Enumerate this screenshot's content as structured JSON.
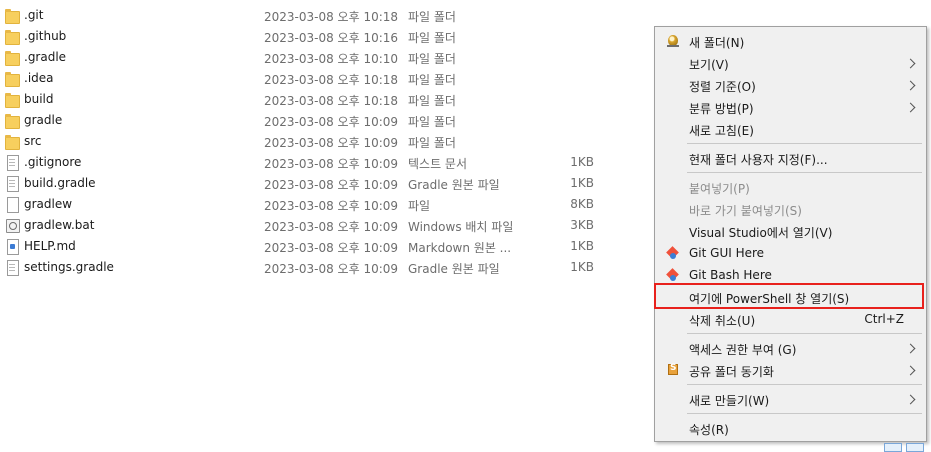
{
  "files": [
    {
      "icon": "folder",
      "name": ".git",
      "date": "2023-03-08 오후 10:18",
      "type": "파일 폴더",
      "size": ""
    },
    {
      "icon": "folder",
      "name": ".github",
      "date": "2023-03-08 오후 10:16",
      "type": "파일 폴더",
      "size": ""
    },
    {
      "icon": "folder",
      "name": ".gradle",
      "date": "2023-03-08 오후 10:10",
      "type": "파일 폴더",
      "size": ""
    },
    {
      "icon": "folder",
      "name": ".idea",
      "date": "2023-03-08 오후 10:18",
      "type": "파일 폴더",
      "size": ""
    },
    {
      "icon": "folder",
      "name": "build",
      "date": "2023-03-08 오후 10:18",
      "type": "파일 폴더",
      "size": ""
    },
    {
      "icon": "folder",
      "name": "gradle",
      "date": "2023-03-08 오후 10:09",
      "type": "파일 폴더",
      "size": ""
    },
    {
      "icon": "folder",
      "name": "src",
      "date": "2023-03-08 오후 10:09",
      "type": "파일 폴더",
      "size": ""
    },
    {
      "icon": "doc-lined",
      "name": ".gitignore",
      "date": "2023-03-08 오후 10:09",
      "type": "텍스트 문서",
      "size": "1KB"
    },
    {
      "icon": "doc-lined",
      "name": "build.gradle",
      "date": "2023-03-08 오후 10:09",
      "type": "Gradle 원본 파일",
      "size": "1KB"
    },
    {
      "icon": "doc",
      "name": "gradlew",
      "date": "2023-03-08 오후 10:09",
      "type": "파일",
      "size": "8KB"
    },
    {
      "icon": "bat",
      "name": "gradlew.bat",
      "date": "2023-03-08 오후 10:09",
      "type": "Windows 배치 파일",
      "size": "3KB"
    },
    {
      "icon": "md",
      "name": "HELP.md",
      "date": "2023-03-08 오후 10:09",
      "type": "Markdown 원본 ...",
      "size": "1KB"
    },
    {
      "icon": "doc-lined",
      "name": "settings.gradle",
      "date": "2023-03-08 오후 10:09",
      "type": "Gradle 원본 파일",
      "size": "1KB"
    }
  ],
  "context_menu": {
    "new_folder": "새 폴더(N)",
    "view": "보기(V)",
    "sort_by": "정렬 기준(O)",
    "group_by": "분류 방법(P)",
    "refresh": "새로 고침(E)",
    "customize_folder": "현재 폴더 사용자 지정(F)...",
    "paste": "붙여넣기(P)",
    "paste_shortcut": "바로 가기 붙여넣기(S)",
    "open_vs": "Visual Studio에서 열기(V)",
    "git_gui": "Git GUI Here",
    "git_bash": "Git Bash Here",
    "open_powershell": "여기에 PowerShell 창 열기(S)",
    "undo_delete": "삭제 취소(U)",
    "undo_delete_accel": "Ctrl+Z",
    "give_access": "액세스 권한 부여 (G)",
    "sync_shared": "공유 폴더 동기화",
    "new": "새로 만들기(W)",
    "properties": "속성(R)"
  },
  "accent": {
    "highlight_border": "#e8211c"
  }
}
